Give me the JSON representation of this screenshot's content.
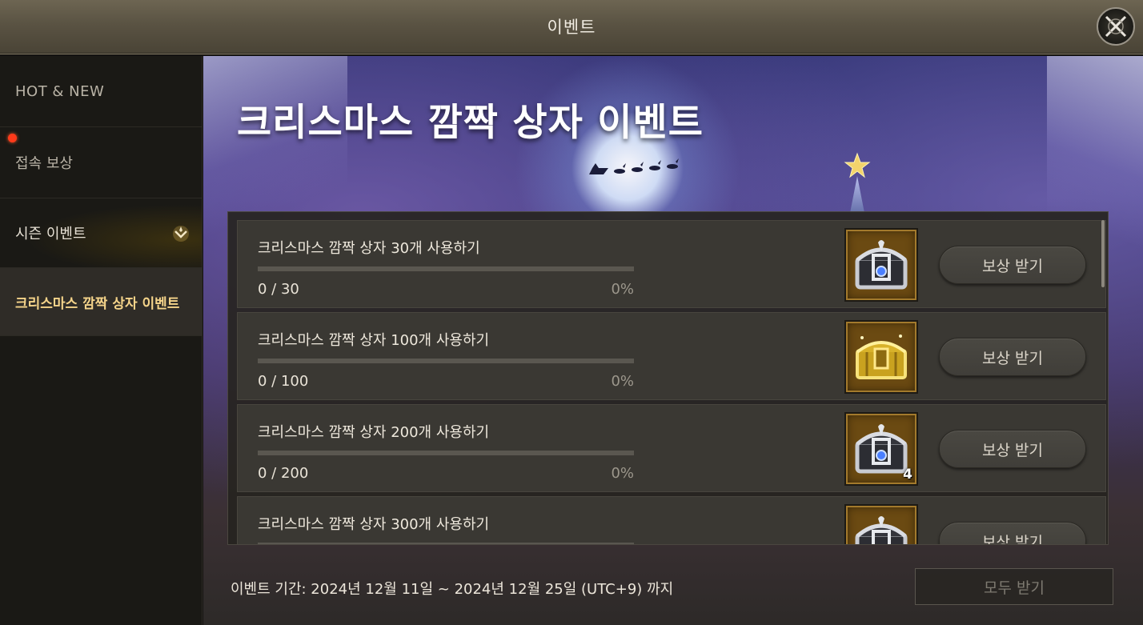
{
  "window": {
    "title": "이벤트",
    "close_icon": "close-x-icon"
  },
  "sidebar": {
    "items": [
      {
        "label": "HOT & NEW"
      },
      {
        "label": "접속 보상",
        "has_notification": true
      },
      {
        "label": "시즌 이벤트",
        "icon": "chevron-down-icon"
      },
      {
        "label": "크리스마스 깜짝 상자 이벤트",
        "active": true
      }
    ]
  },
  "banner": {
    "title": "크리스마스 깜짝 상자 이벤트"
  },
  "missions": [
    {
      "title": "크리스마스 깜짝 상자 30개 사용하기",
      "progress": "0 / 30",
      "percent": "0%",
      "reward_icon": "silver-chest-icon",
      "reward_qty": "",
      "button": "보상 받기"
    },
    {
      "title": "크리스마스 깜짝 상자 100개 사용하기",
      "progress": "0 / 100",
      "percent": "0%",
      "reward_icon": "gold-chest-icon",
      "reward_qty": "",
      "button": "보상 받기"
    },
    {
      "title": "크리스마스 깜짝 상자 200개 사용하기",
      "progress": "0 / 200",
      "percent": "0%",
      "reward_icon": "silver-chest-icon",
      "reward_qty": "4",
      "button": "보상 받기"
    },
    {
      "title": "크리스마스 깜짝 상자 300개 사용하기",
      "progress": "",
      "percent": "",
      "reward_icon": "silver-chest-icon",
      "reward_qty": "",
      "button": "보상 받기"
    }
  ],
  "footer": {
    "period": "이벤트 기간: 2024년 12월 11일 ~ 2024년 12월 25일 (UTC+9) 까지",
    "claim_all": "모두 받기"
  },
  "colors": {
    "accent_gold": "#f5d48a",
    "notification_red": "#ff3a1a"
  }
}
